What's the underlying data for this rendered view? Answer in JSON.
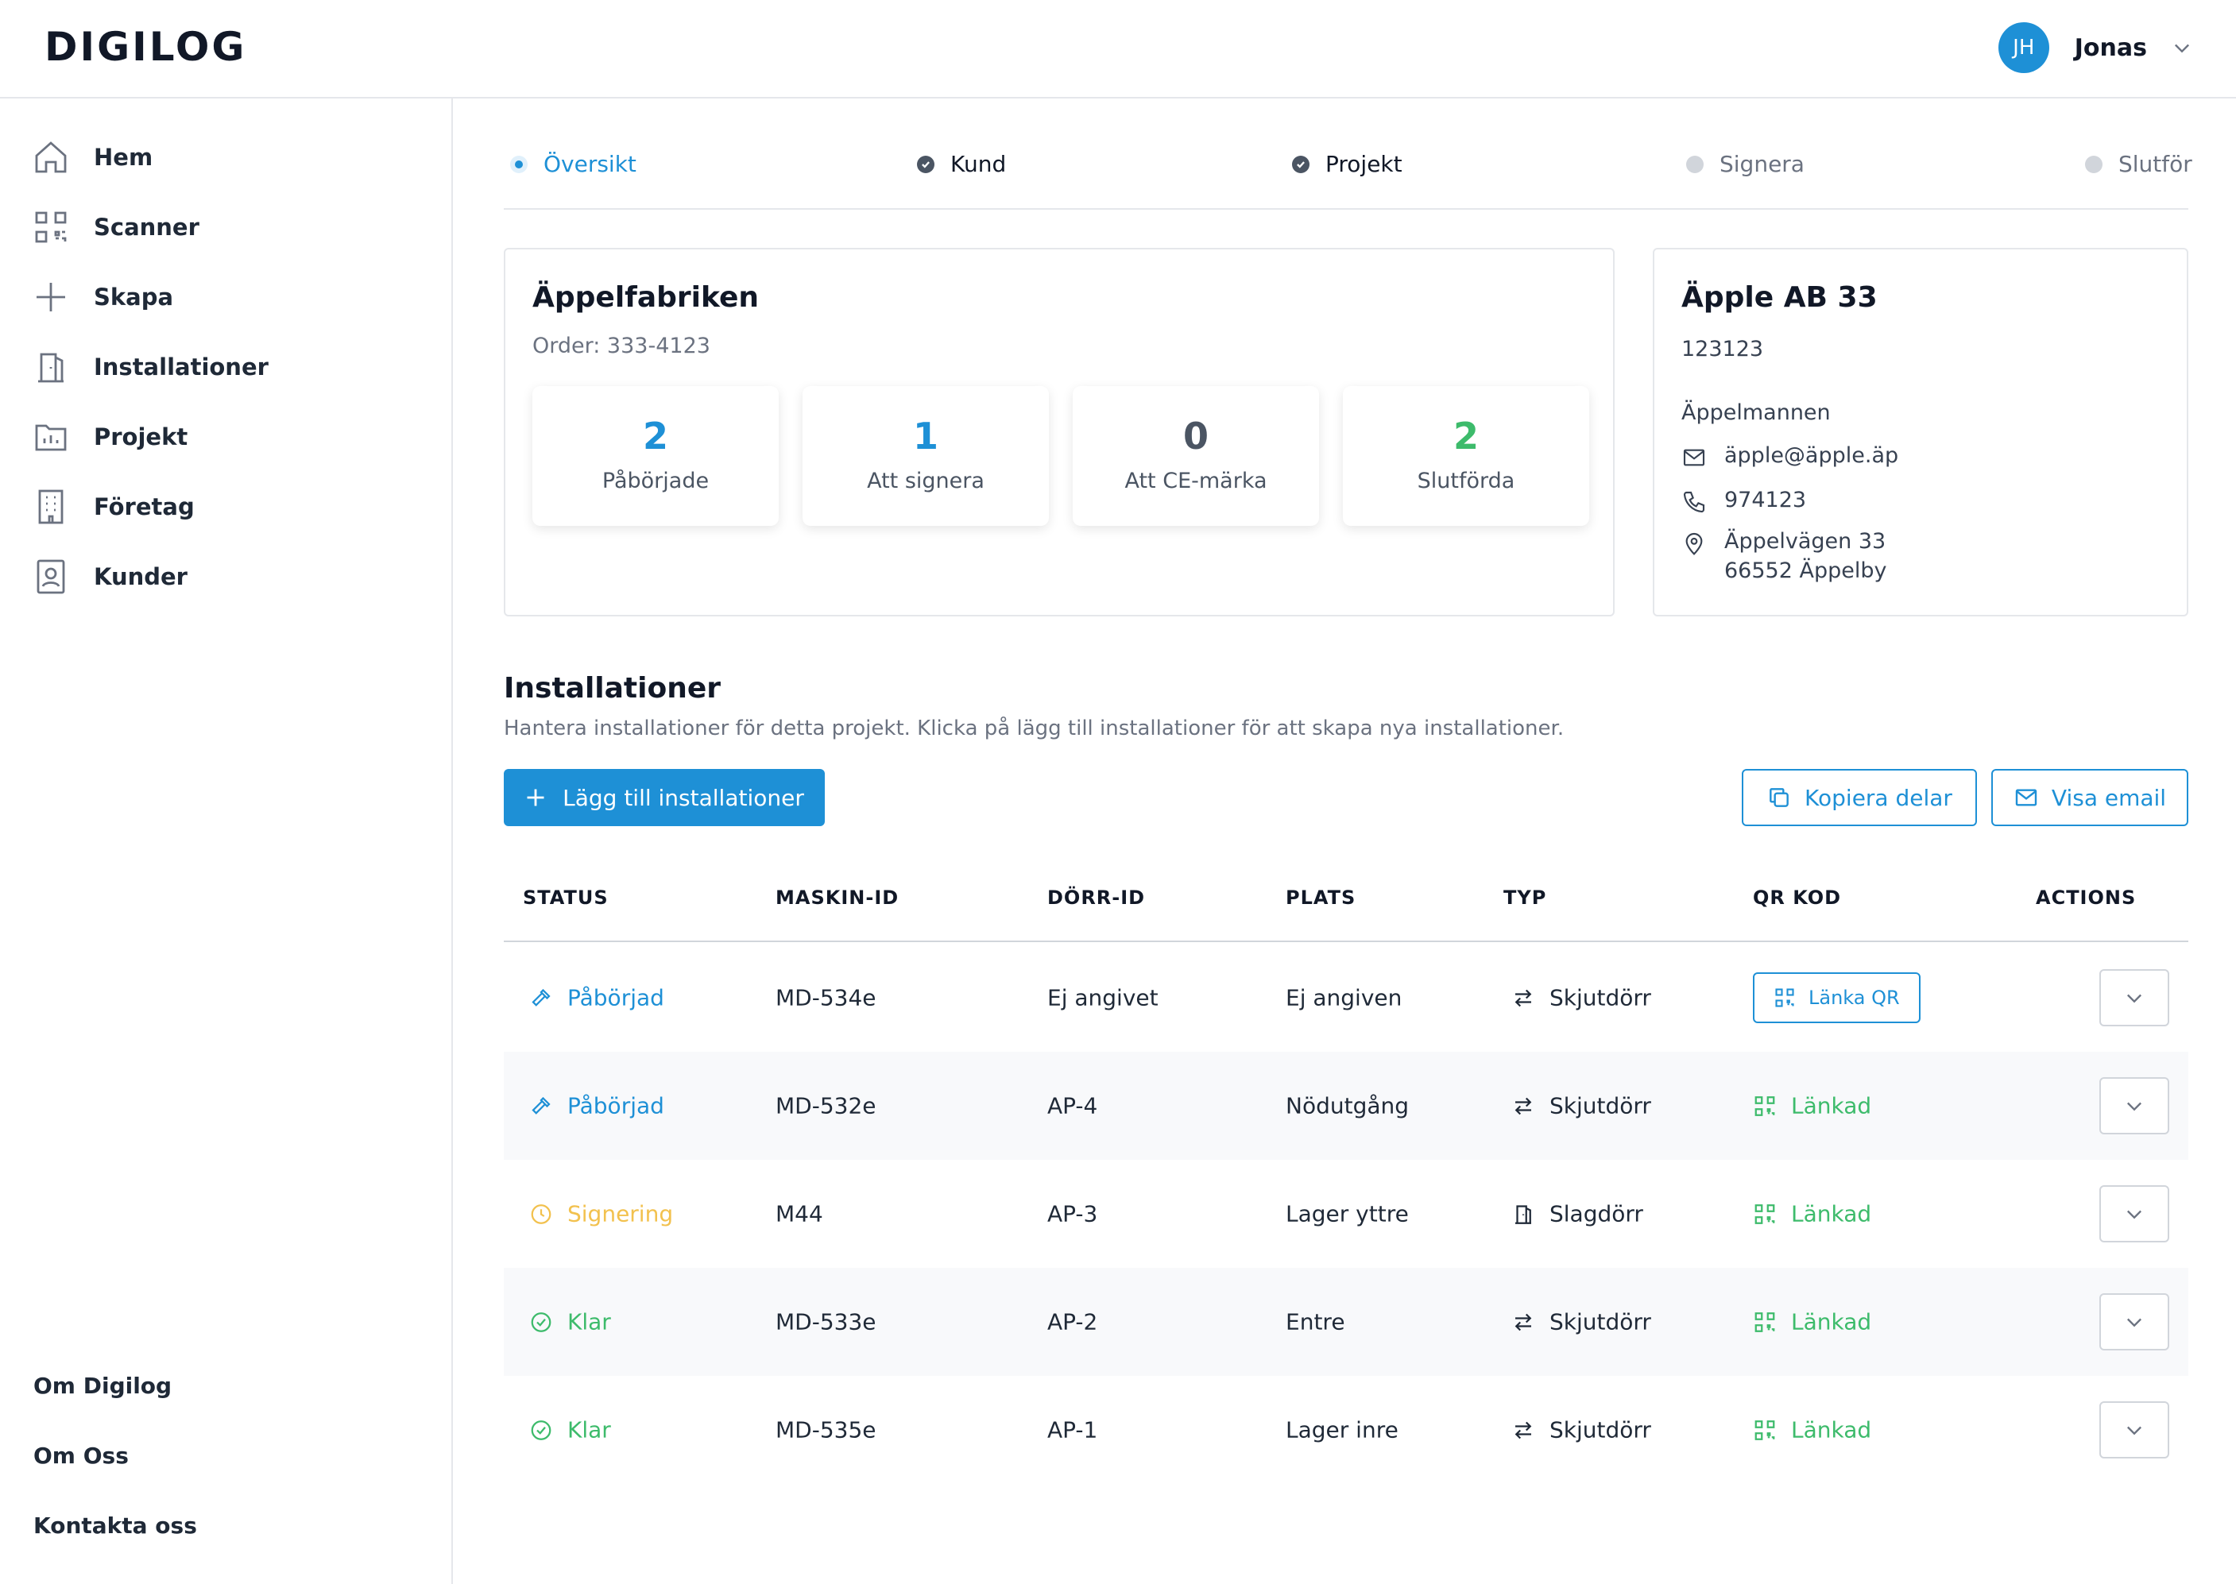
{
  "app": {
    "logo": "DIGILOG"
  },
  "user": {
    "initials": "JH",
    "name": "Jonas"
  },
  "sidebar": {
    "items": [
      {
        "label": "Hem",
        "icon": "home-icon"
      },
      {
        "label": "Scanner",
        "icon": "qr-scan-icon"
      },
      {
        "label": "Skapa",
        "icon": "plus-icon"
      },
      {
        "label": "Installationer",
        "icon": "door-icon"
      },
      {
        "label": "Projekt",
        "icon": "folder-chart-icon"
      },
      {
        "label": "Företag",
        "icon": "building-icon"
      },
      {
        "label": "Kunder",
        "icon": "contact-book-icon"
      }
    ],
    "footer": [
      "Om Digilog",
      "Om Oss",
      "Kontakta oss"
    ]
  },
  "stepper": {
    "steps": [
      {
        "label": "Översikt",
        "state": "current"
      },
      {
        "label": "Kund",
        "state": "done"
      },
      {
        "label": "Projekt",
        "state": "done"
      },
      {
        "label": "Signera",
        "state": "pending"
      },
      {
        "label": "Slutför",
        "state": "pending"
      }
    ]
  },
  "project": {
    "name": "Äppelfabriken",
    "order": "Order: 333-4123",
    "stats": [
      {
        "value": "2",
        "label": "Påbörjade",
        "color": "#1e90d6"
      },
      {
        "value": "1",
        "label": "Att signera",
        "color": "#1e90d6"
      },
      {
        "value": "0",
        "label": "Att CE-märka",
        "color": "#4b5563"
      },
      {
        "value": "2",
        "label": "Slutförda",
        "color": "#3dbb6b"
      }
    ]
  },
  "customer": {
    "name": "Äpple AB 33",
    "number": "123123",
    "contact": "Äppelmannen",
    "email": "äpple@äpple.äp",
    "phone": "974123",
    "address_line1": "Äppelvägen 33",
    "address_line2": "66552 Äppelby"
  },
  "installations": {
    "title": "Installationer",
    "description": "Hantera installationer för detta projekt. Klicka på lägg till installationer för att skapa nya installationer.",
    "add_button": "Lägg till installationer",
    "copy_button": "Kopiera delar",
    "email_button": "Visa email",
    "columns": [
      "STATUS",
      "MASKIN-ID",
      "DÖRR-ID",
      "PLATS",
      "TYP",
      "QR KOD",
      "ACTIONS"
    ],
    "rows": [
      {
        "status": "Påbörjad",
        "status_kind": "started",
        "machine_id": "MD-534e",
        "door_id": "Ej angivet",
        "place": "Ej angiven",
        "type": "Skjutdörr",
        "type_icon": "swap-arrows-icon",
        "qr": "Länka QR",
        "qr_linked": false
      },
      {
        "status": "Påbörjad",
        "status_kind": "started",
        "machine_id": "MD-532e",
        "door_id": "AP-4",
        "place": "Nödutgång",
        "type": "Skjutdörr",
        "type_icon": "swap-arrows-icon",
        "qr": "Länkad",
        "qr_linked": true
      },
      {
        "status": "Signering",
        "status_kind": "signing",
        "machine_id": "M44",
        "door_id": "AP-3",
        "place": "Lager yttre",
        "type": "Slagdörr",
        "type_icon": "door-icon",
        "qr": "Länkad",
        "qr_linked": true
      },
      {
        "status": "Klar",
        "status_kind": "done",
        "machine_id": "MD-533e",
        "door_id": "AP-2",
        "place": "Entre",
        "type": "Skjutdörr",
        "type_icon": "swap-arrows-icon",
        "qr": "Länkad",
        "qr_linked": true
      },
      {
        "status": "Klar",
        "status_kind": "done",
        "machine_id": "MD-535e",
        "door_id": "AP-1",
        "place": "Lager inre",
        "type": "Skjutdörr",
        "type_icon": "swap-arrows-icon",
        "qr": "Länkad",
        "qr_linked": true
      }
    ]
  },
  "colors": {
    "accent": "#1e90d6",
    "success": "#3dbb6b",
    "warning": "#f2c14e"
  }
}
